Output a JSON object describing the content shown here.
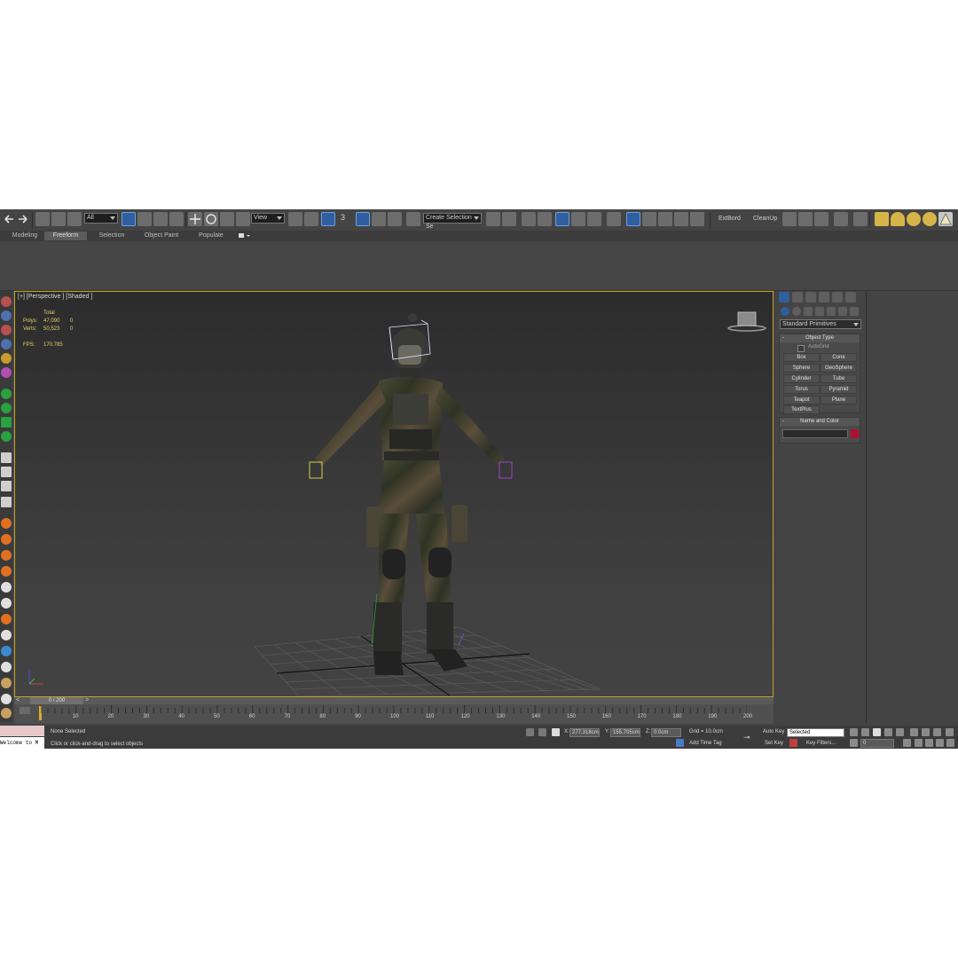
{
  "toolbar": {
    "selection_filter": "All",
    "reference_coord": "View",
    "snap_label": "3",
    "named_selection": "Create Selection Se",
    "extbord_label": "ExtBord",
    "cleanup_label": "CleanUp"
  },
  "ribbon": {
    "tabs": [
      "Modeling",
      "Freeform",
      "Selection",
      "Object Paint",
      "Populate"
    ],
    "active_tab": "Freeform"
  },
  "viewport": {
    "label": "[+] [Perspective ] [Shaded ]",
    "stats": {
      "total_label": "Total",
      "polys_label": "Polys:",
      "polys_total": "47,090",
      "polys_sel": "0",
      "verts_label": "Verts:",
      "verts_total": "50,523",
      "verts_sel": "0",
      "fps_label": "FPS:",
      "fps_value": "170.785"
    }
  },
  "command_panel": {
    "category_dropdown": "Standard Primitives",
    "object_type_title": "Object Type",
    "autogrid_label": "AutoGrid",
    "buttons": [
      "Box",
      "Cone",
      "Sphere",
      "GeoSphere",
      "Cylinder",
      "Tube",
      "Torus",
      "Pyramid",
      "Teapot",
      "Plane",
      "TextPlus"
    ],
    "name_color_title": "Name and Color",
    "object_color": "#b01030"
  },
  "timeline": {
    "slider_label": "0 / 200",
    "ticks": [
      "10",
      "20",
      "30",
      "40",
      "50",
      "60",
      "70",
      "80",
      "90",
      "100",
      "110",
      "120",
      "130",
      "140",
      "150",
      "160",
      "170",
      "180",
      "190",
      "200"
    ]
  },
  "status": {
    "selection_status": "None Selected",
    "prompt": "Click or click-and-drag to select objects",
    "maxscript": "Welcome to M",
    "x_label": "X:",
    "x_value": "277.318cm",
    "y_label": "Y:",
    "y_value": "155.705cm",
    "z_label": "Z:",
    "z_value": "0.0cm",
    "grid": "Grid = 10.0cm",
    "add_time_tag": "Add Time Tag",
    "auto_key": "Auto Key",
    "set_key": "Set Key",
    "key_mode": "Selected",
    "key_filters": "Key Filters...",
    "frame_value": "0"
  }
}
